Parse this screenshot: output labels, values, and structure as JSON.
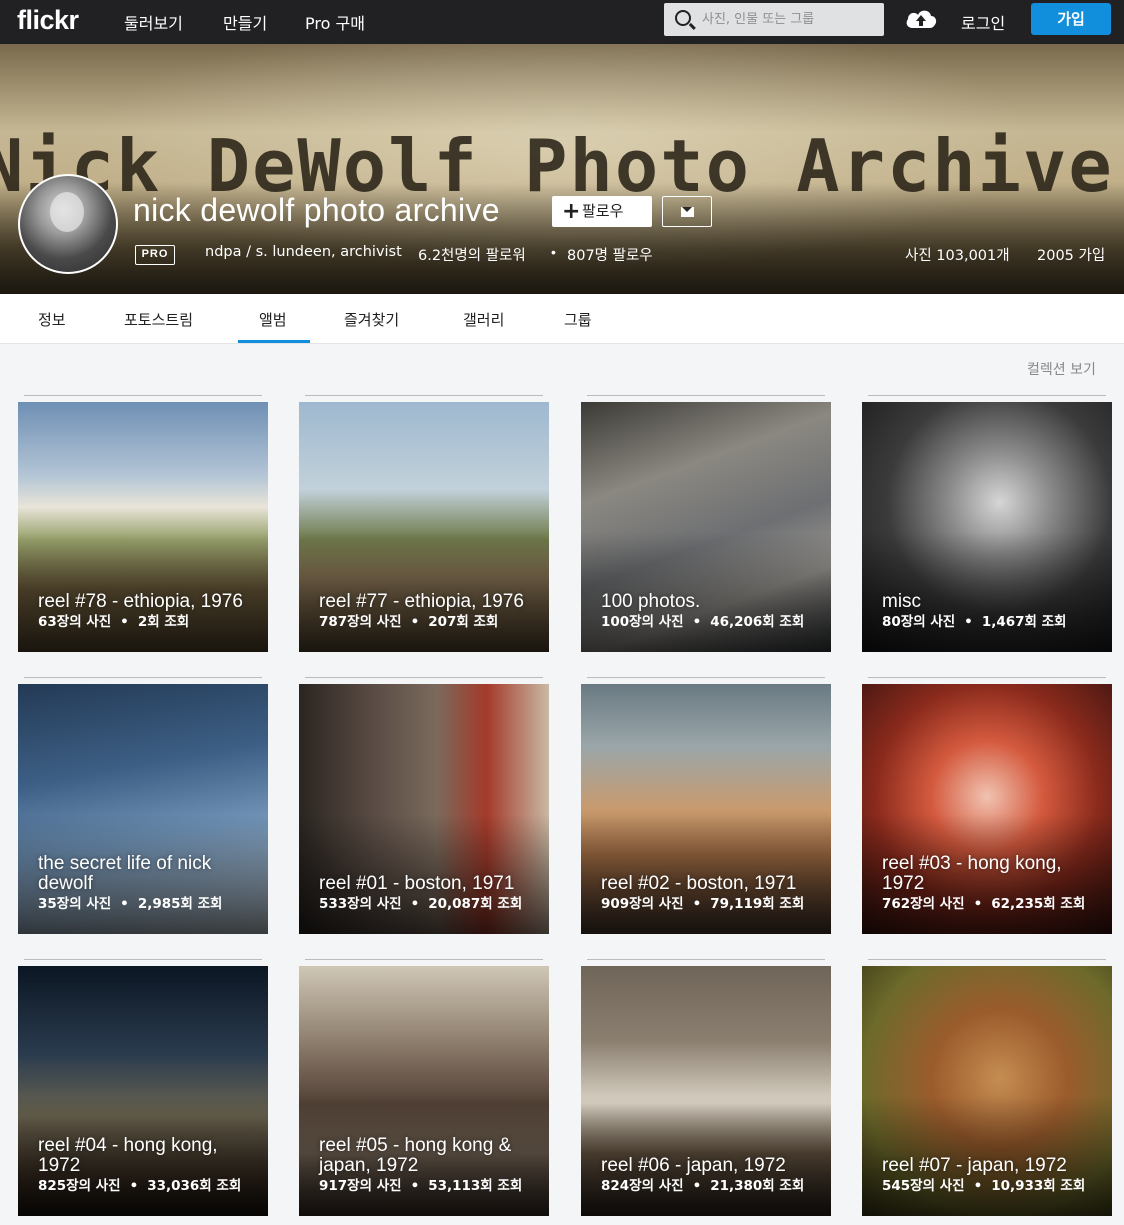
{
  "topnav": {
    "logo": "flickr",
    "links": [
      "둘러보기",
      "만들기",
      "Pro 구매"
    ],
    "search_placeholder": "사진, 인물 또는 그룹",
    "login": "로그인",
    "signup": "가입"
  },
  "cover": {
    "typed_text": "Nick DeWolf Photo Archive"
  },
  "profile": {
    "name": "nick dewolf photo archive",
    "follow_label": "팔로우",
    "pro_badge": "PRO",
    "real_name": "ndpa / s. lundeen, archivist",
    "followers": "6.2천명의 팔로워",
    "following": "807명 팔로우",
    "photos": "사진 103,001개",
    "joined": "2005 가입"
  },
  "tabs": [
    "정보",
    "포토스트림",
    "앨범",
    "즐겨찾기",
    "갤러리",
    "그룹"
  ],
  "active_tab": "앨범",
  "collection_link": "컬렉션 보기",
  "albums": [
    {
      "title": "reel #78 - ethiopia, 1976",
      "photos": "63장의 사진",
      "views": "2회 조회"
    },
    {
      "title": "reel #77 - ethiopia, 1976",
      "photos": "787장의 사진",
      "views": "207회 조회"
    },
    {
      "title": "100 photos.",
      "photos": "100장의 사진",
      "views": "46,206회 조회"
    },
    {
      "title": "misc",
      "photos": "80장의 사진",
      "views": "1,467회 조회"
    },
    {
      "title": "the secret life of nick dewolf",
      "photos": "35장의 사진",
      "views": "2,985회 조회"
    },
    {
      "title": "reel #01 - boston, 1971",
      "photos": "533장의 사진",
      "views": "20,087회 조회"
    },
    {
      "title": "reel #02 - boston, 1971",
      "photos": "909장의 사진",
      "views": "79,119회 조회"
    },
    {
      "title": "reel #03 - hong kong, 1972",
      "photos": "762장의 사진",
      "views": "62,235회 조회"
    },
    {
      "title": "reel #04 - hong kong, 1972",
      "photos": "825장의 사진",
      "views": "33,036회 조회"
    },
    {
      "title": "reel #05 - hong kong & japan, 1972",
      "photos": "917장의 사진",
      "views": "53,113회 조회"
    },
    {
      "title": "reel #06 - japan, 1972",
      "photos": "824장의 사진",
      "views": "21,380회 조회"
    },
    {
      "title": "reel #07 - japan, 1972",
      "photos": "545장의 사진",
      "views": "10,933회 조회"
    }
  ],
  "colors": {
    "topbar": "#212124",
    "accent": "#128fdc",
    "page_bg": "#f3f5f6"
  },
  "icons": {
    "search": "search-icon",
    "upload": "cloud-upload-icon",
    "mail": "mail-icon",
    "follow": "plus-icon"
  }
}
